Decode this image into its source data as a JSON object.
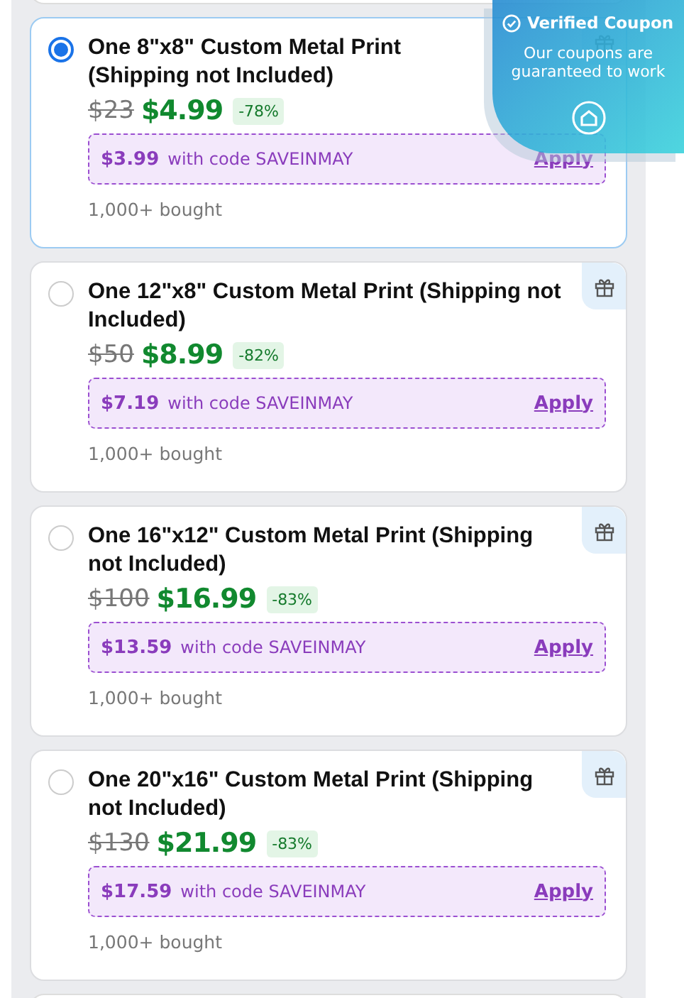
{
  "products": [
    {
      "title": "One 8\"x8\" Custom Metal Print (Shipping not Included)",
      "selected": true,
      "old_price": "$23",
      "price": "$4.99",
      "discount": "-78%",
      "coupon_price": "$3.99",
      "coupon_text": "with code SAVEINMAY",
      "apply": "Apply",
      "sold": "1,000+ bought"
    },
    {
      "title": "One 12\"x8\" Custom Metal Print (Shipping not Included)",
      "selected": false,
      "old_price": "$50",
      "price": "$8.99",
      "discount": "-82%",
      "coupon_price": "$7.19",
      "coupon_text": "with code SAVEINMAY",
      "apply": "Apply",
      "sold": "1,000+ bought"
    },
    {
      "title": "One 16\"x12\" Custom Metal Print (Shipping not Included)",
      "selected": false,
      "old_price": "$100",
      "price": "$16.99",
      "discount": "-83%",
      "coupon_price": "$13.59",
      "coupon_text": "with code SAVEINMAY",
      "apply": "Apply",
      "sold": "1,000+ bought"
    },
    {
      "title": "One 20\"x16\" Custom Metal Print (Shipping not Included)",
      "selected": false,
      "old_price": "$130",
      "price": "$21.99",
      "discount": "-83%",
      "coupon_price": "$17.59",
      "coupon_text": "with code SAVEINMAY",
      "apply": "Apply",
      "sold": "1,000+ bought"
    }
  ],
  "verified_popup": {
    "title": "Verified Coupon",
    "text": "Our coupons are guaranteed to work"
  }
}
